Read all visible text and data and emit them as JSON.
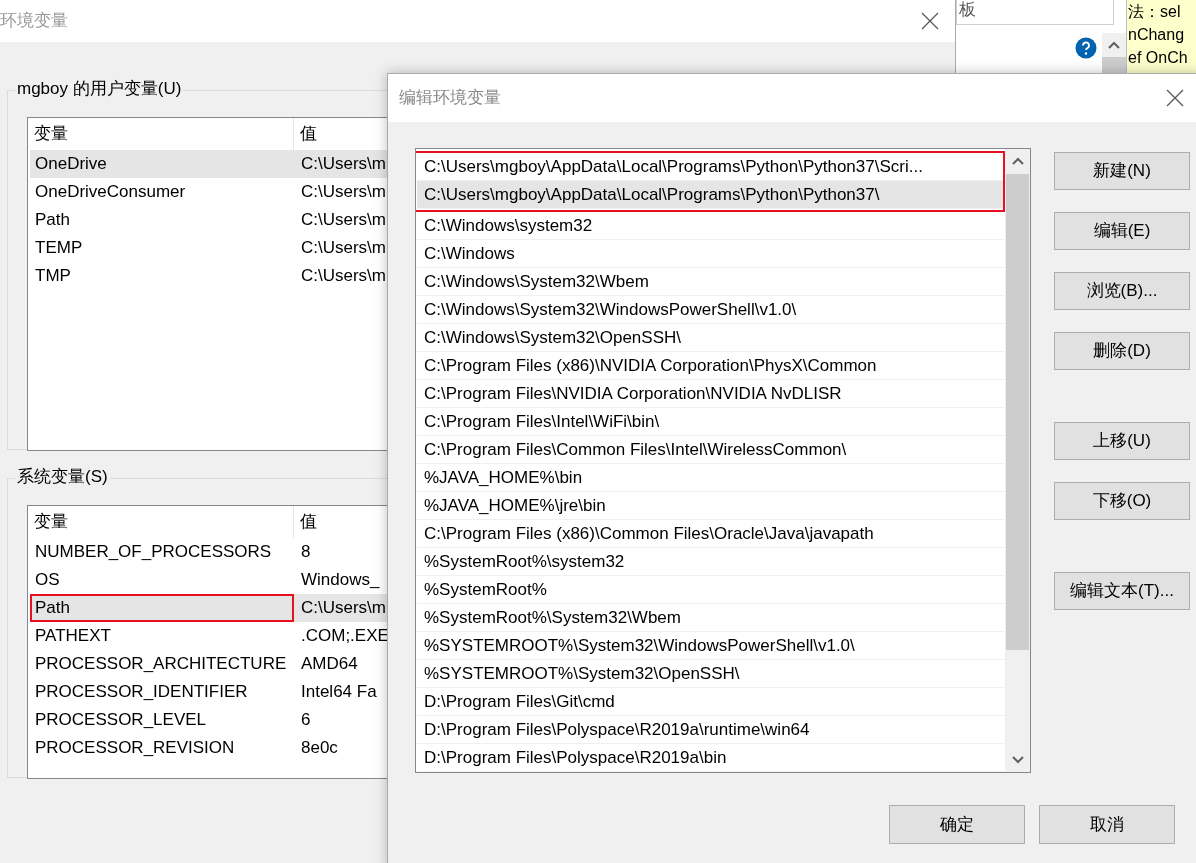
{
  "background_app": {
    "field_text": "板",
    "note_lines": [
      "法：sel",
      "nChang",
      "ef OnCh"
    ]
  },
  "env_window": {
    "title": "环境变量",
    "user_group": {
      "title": "mgboy 的用户变量(U)",
      "columns": [
        "变量",
        "值"
      ],
      "rows": [
        {
          "name": "OneDrive",
          "value": "C:\\Users\\m",
          "selected": true,
          "annotated": false
        },
        {
          "name": "OneDriveConsumer",
          "value": "C:\\Users\\m",
          "selected": false,
          "annotated": false
        },
        {
          "name": "Path",
          "value": "C:\\Users\\m",
          "selected": false,
          "annotated": false
        },
        {
          "name": "TEMP",
          "value": "C:\\Users\\m",
          "selected": false,
          "annotated": false
        },
        {
          "name": "TMP",
          "value": "C:\\Users\\m",
          "selected": false,
          "annotated": false
        }
      ]
    },
    "system_group": {
      "title": "系统变量(S)",
      "columns": [
        "变量",
        "值"
      ],
      "rows": [
        {
          "name": "NUMBER_OF_PROCESSORS",
          "value": "8",
          "selected": false,
          "annotated": false
        },
        {
          "name": "OS",
          "value": "Windows_",
          "selected": false,
          "annotated": false
        },
        {
          "name": "Path",
          "value": "C:\\Users\\m",
          "selected": true,
          "annotated": true
        },
        {
          "name": "PATHEXT",
          "value": ".COM;.EXE",
          "selected": false,
          "annotated": false
        },
        {
          "name": "PROCESSOR_ARCHITECTURE",
          "value": "AMD64",
          "selected": false,
          "annotated": false
        },
        {
          "name": "PROCESSOR_IDENTIFIER",
          "value": "Intel64 Fa",
          "selected": false,
          "annotated": false
        },
        {
          "name": "PROCESSOR_LEVEL",
          "value": "6",
          "selected": false,
          "annotated": false
        },
        {
          "name": "PROCESSOR_REVISION",
          "value": "8e0c",
          "selected": false,
          "annotated": false
        }
      ]
    }
  },
  "edit_dialog": {
    "title": "编辑环境变量",
    "paths": [
      {
        "text": "C:\\Users\\mgboy\\AppData\\Local\\Programs\\Python\\Python37\\Scri...",
        "selected": false,
        "annotated": true
      },
      {
        "text": "C:\\Users\\mgboy\\AppData\\Local\\Programs\\Python\\Python37\\",
        "selected": true,
        "annotated": true
      },
      {
        "text": "C:\\Windows\\system32",
        "selected": false,
        "annotated": false
      },
      {
        "text": "C:\\Windows",
        "selected": false,
        "annotated": false
      },
      {
        "text": "C:\\Windows\\System32\\Wbem",
        "selected": false,
        "annotated": false
      },
      {
        "text": "C:\\Windows\\System32\\WindowsPowerShell\\v1.0\\",
        "selected": false,
        "annotated": false
      },
      {
        "text": "C:\\Windows\\System32\\OpenSSH\\",
        "selected": false,
        "annotated": false
      },
      {
        "text": "C:\\Program Files (x86)\\NVIDIA Corporation\\PhysX\\Common",
        "selected": false,
        "annotated": false
      },
      {
        "text": "C:\\Program Files\\NVIDIA Corporation\\NVIDIA NvDLISR",
        "selected": false,
        "annotated": false
      },
      {
        "text": "C:\\Program Files\\Intel\\WiFi\\bin\\",
        "selected": false,
        "annotated": false
      },
      {
        "text": "C:\\Program Files\\Common Files\\Intel\\WirelessCommon\\",
        "selected": false,
        "annotated": false
      },
      {
        "text": "%JAVA_HOME%\\bin",
        "selected": false,
        "annotated": false
      },
      {
        "text": "%JAVA_HOME%\\jre\\bin",
        "selected": false,
        "annotated": false
      },
      {
        "text": "C:\\Program Files (x86)\\Common Files\\Oracle\\Java\\javapath",
        "selected": false,
        "annotated": false
      },
      {
        "text": "%SystemRoot%\\system32",
        "selected": false,
        "annotated": false
      },
      {
        "text": "%SystemRoot%",
        "selected": false,
        "annotated": false
      },
      {
        "text": "%SystemRoot%\\System32\\Wbem",
        "selected": false,
        "annotated": false
      },
      {
        "text": "%SYSTEMROOT%\\System32\\WindowsPowerShell\\v1.0\\",
        "selected": false,
        "annotated": false
      },
      {
        "text": "%SYSTEMROOT%\\System32\\OpenSSH\\",
        "selected": false,
        "annotated": false
      },
      {
        "text": "D:\\Program Files\\Git\\cmd",
        "selected": false,
        "annotated": false
      },
      {
        "text": "D:\\Program Files\\Polyspace\\R2019a\\runtime\\win64",
        "selected": false,
        "annotated": false
      },
      {
        "text": "D:\\Program Files\\Polyspace\\R2019a\\bin",
        "selected": false,
        "annotated": false
      }
    ],
    "side_button_groups": [
      [
        "新建(N)",
        "编辑(E)",
        "浏览(B)...",
        "删除(D)"
      ],
      [
        "上移(U)",
        "下移(O)"
      ],
      [
        "编辑文本(T)..."
      ]
    ],
    "footer_buttons": [
      "确定",
      "取消"
    ]
  }
}
